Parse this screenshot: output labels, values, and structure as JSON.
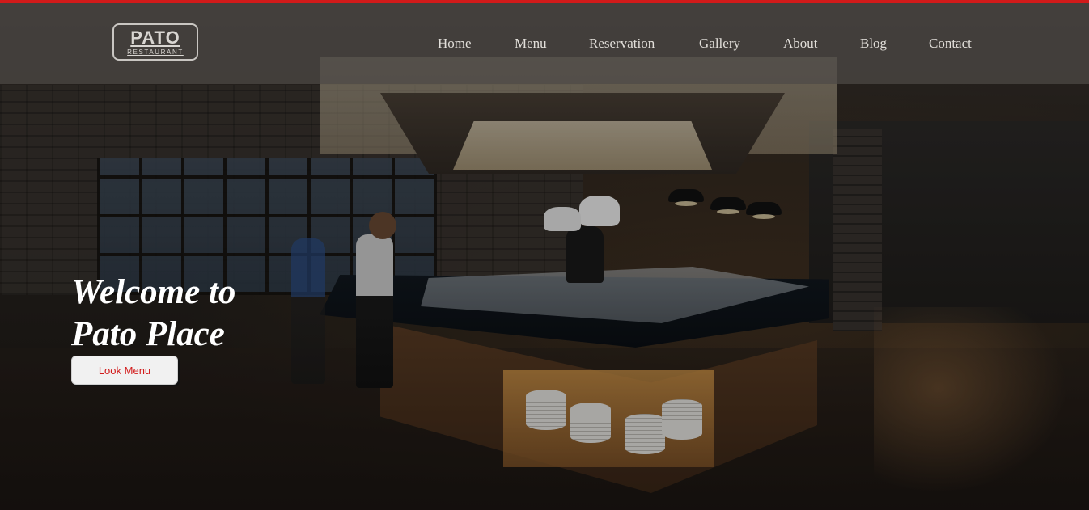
{
  "header": {
    "logo": {
      "main": "PATO",
      "sub": "RESTAURANT"
    },
    "accent_color": "#d21a1a",
    "nav": [
      {
        "label": "Home"
      },
      {
        "label": "Menu"
      },
      {
        "label": "Reservation"
      },
      {
        "label": "Gallery"
      },
      {
        "label": "About"
      },
      {
        "label": "Blog"
      },
      {
        "label": "Contact"
      }
    ]
  },
  "hero": {
    "title_line1": "Welcome to",
    "title_line2": "Pato Place",
    "cta_label": "Look Menu",
    "cta_text_color": "#d21a1a",
    "background_image": "restaurant-kitchen-photo"
  }
}
